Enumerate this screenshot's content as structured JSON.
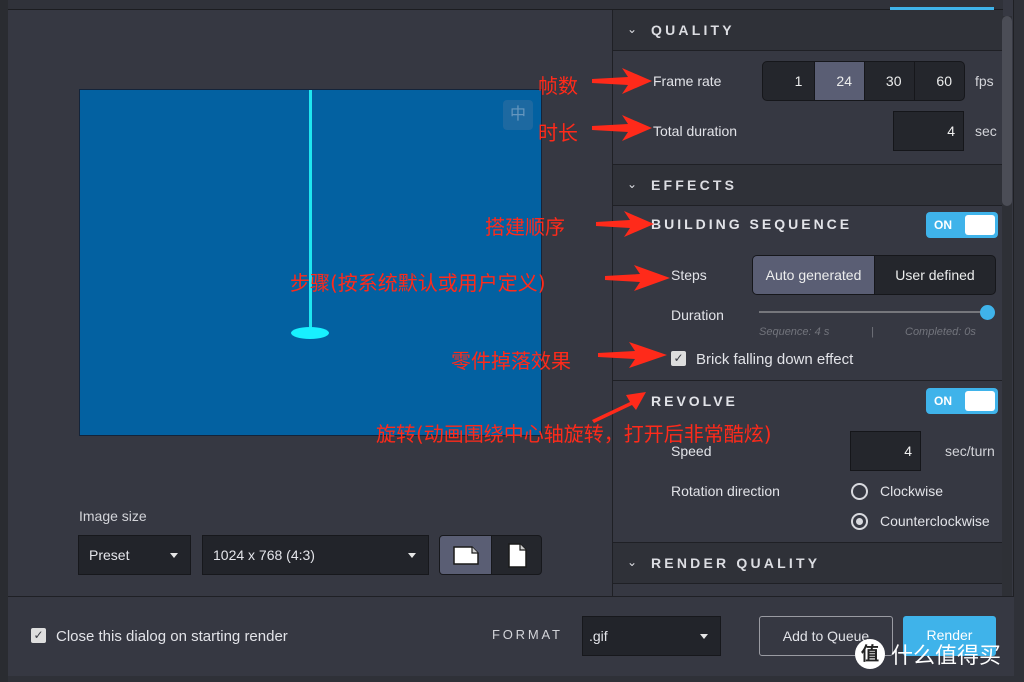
{
  "preview": {
    "center_button_glyph": "中",
    "image_size_label": "Image size",
    "preset_select": "Preset",
    "resolution_select": "1024 x 768 (4:3)",
    "orientation": {
      "options": [
        "landscape",
        "portrait"
      ],
      "selected": "landscape"
    }
  },
  "quality": {
    "title": "QUALITY",
    "frame_rate_label": "Frame rate",
    "frame_rate_options": [
      "1",
      "24",
      "30",
      "60"
    ],
    "frame_rate_selected": "24",
    "frame_rate_unit": "fps",
    "total_duration_label": "Total duration",
    "total_duration_value": "4",
    "total_duration_unit": "sec"
  },
  "effects": {
    "title": "EFFECTS",
    "building_sequence": {
      "title": "BUILDING SEQUENCE",
      "toggle_label": "ON",
      "enabled": true,
      "steps_label": "Steps",
      "steps_options": [
        "Auto generated",
        "User defined"
      ],
      "steps_selected": "Auto generated",
      "duration_label": "Duration",
      "duration_slider_fraction": 1.0,
      "sequence_hint": "Sequence: 4 s",
      "hint_separator": "|",
      "completed_hint": "Completed: 0s",
      "brick_falling_label": "Brick falling down effect",
      "brick_falling_checked": true
    },
    "revolve": {
      "title": "REVOLVE",
      "toggle_label": "ON",
      "enabled": true,
      "speed_label": "Speed",
      "speed_value": "4",
      "speed_unit": "sec/turn",
      "rotation_direction_label": "Rotation direction",
      "rotation_options": [
        "Clockwise",
        "Counterclockwise"
      ],
      "rotation_selected": "Counterclockwise"
    }
  },
  "render_quality": {
    "title": "RENDER QUALITY"
  },
  "footer": {
    "close_dialog_label": "Close this dialog on starting render",
    "close_dialog_checked": true,
    "format_label": "FORMAT",
    "format_value": ".gif",
    "add_to_queue_label": "Add to Queue",
    "render_label": "Render"
  },
  "annotations": {
    "frame_rate": "帧数",
    "duration": "时长",
    "building_sequence": "搭建顺序",
    "steps": "步骤(按系统默认或用户定义)",
    "brick_falling": "零件掉落效果",
    "revolve": "旋转(动画围绕中心轴旋转，打开后非常酷炫)"
  },
  "watermark": {
    "badge": "值",
    "text": "什么值得买"
  },
  "colors": {
    "accent": "#3fb3ea",
    "annotation_red": "#ff2a1a",
    "canvas_blue": "#0361a1",
    "axis_cyan": "#1ee6f0"
  }
}
